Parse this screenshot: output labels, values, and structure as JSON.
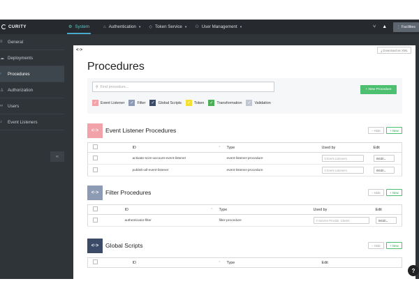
{
  "brand": "CURITY",
  "nav": {
    "tabs": [
      {
        "label": "System",
        "icon": "gear-icon",
        "active": true
      },
      {
        "label": "Authentication",
        "icon": "lock-icon",
        "caret": true
      },
      {
        "label": "Token Service",
        "icon": "tag-icon",
        "caret": true
      },
      {
        "label": "User Management",
        "icon": "user-icon",
        "caret": true
      }
    ],
    "facilities": "⋮ Facilities"
  },
  "sidebar": {
    "items": [
      {
        "label": "General",
        "icon": "sliders-icon"
      },
      {
        "label": "Deployments",
        "icon": "cloud-icon"
      },
      {
        "label": "Procedures",
        "icon": "code-icon",
        "active": true
      },
      {
        "label": "Authorization",
        "icon": "user-icon"
      },
      {
        "label": "Users",
        "icon": "users-icon"
      },
      {
        "label": "Event Listeners",
        "icon": "bell-icon"
      }
    ],
    "collapse": "‹‹"
  },
  "panel": {
    "code_icon": "<·>",
    "download_label": "⤓ Download as XML",
    "title": "Procedures",
    "search_placeholder": "Find procedure...",
    "new_procedure": "+ New Procedure",
    "filters": [
      {
        "label": "Event Listener",
        "color": "#f2a3a9"
      },
      {
        "label": "Filter",
        "color": "#8c9bb3"
      },
      {
        "label": "Global Scripts",
        "color": "#3b4a66"
      },
      {
        "label": "Token",
        "color": "#f3e035"
      },
      {
        "label": "Transformation",
        "color": "#4cae57"
      },
      {
        "label": "Validation",
        "color": "#c1c7d0"
      }
    ]
  },
  "sections": {
    "event_listener": {
      "title": "Event Listener Procedures",
      "icon_color": "#f2a3a9",
      "icon": "<·>",
      "hide": "– Hide",
      "new": "+ New",
      "headers": {
        "id": "ID",
        "type": "Type",
        "used_by": "Used by",
        "edit": "Edit"
      },
      "rows": [
        {
          "id": "activate-scim-account-event-listener",
          "type": "event-listener-procedure",
          "used_by": "0 Event Listeners",
          "edit": "Edit"
        },
        {
          "id": "publish-all-event-listener",
          "type": "event-listener-procedure",
          "used_by": "0 Event Listeners",
          "edit": "Edit"
        }
      ]
    },
    "filter": {
      "title": "Filter Procedures",
      "icon_color": "#8c9bb3",
      "icon": "<·>",
      "hide": "– Hide",
      "new": "+ New",
      "headers": {
        "id": "ID",
        "type": "Type",
        "used_by": "Used by",
        "edit": "Edit"
      },
      "rows": [
        {
          "id": "authenticator-filter",
          "type": "filter-procedure",
          "used_by": "0 Service Provide, Clients",
          "edit": "Edit"
        }
      ]
    },
    "global": {
      "title": "Global Scripts",
      "icon_color": "#3b4a66",
      "icon": "<·>",
      "hide": "– Hide",
      "new": "+ New",
      "headers": {
        "id": "ID",
        "type": "Type",
        "edit": "Edit"
      }
    }
  },
  "help": "?"
}
